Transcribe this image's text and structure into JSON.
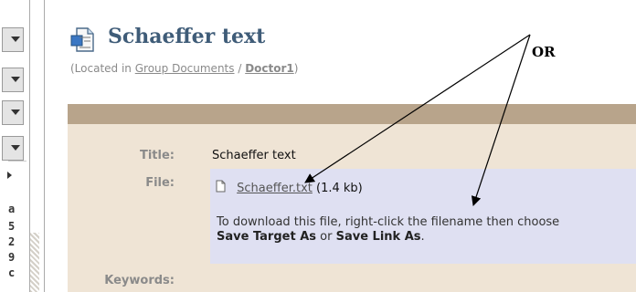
{
  "page": {
    "title": "Schaeffer text",
    "location": {
      "prefix": "(Located in ",
      "group": "Group Documents",
      "sep": " / ",
      "folder": "Doctor1",
      "suffix": ")"
    }
  },
  "details": {
    "title_label": "Title:",
    "title_value": "Schaeffer text",
    "file_label": "File:",
    "file_name": "Schaeffer.txt",
    "file_size": "(1.4 kb)",
    "note_part1": "To download this file, right-click the filename then choose",
    "note_bold1": "Save Target As",
    "note_or": " or ",
    "note_bold2": "Save Link As",
    "note_end": ".",
    "keywords_label": "Keywords:"
  },
  "annotation": {
    "text": "OR"
  },
  "sidebar": {
    "chars": [
      "a",
      "5",
      "2",
      "9",
      "c"
    ]
  },
  "colors": {
    "title": "#3f5c78",
    "panel": "#efe4d5",
    "panel_header": "#b8a48b",
    "file_box": "#dfe0f2"
  },
  "icons": [
    "document-icon",
    "file-icon",
    "dropdown-arrow-icon"
  ]
}
